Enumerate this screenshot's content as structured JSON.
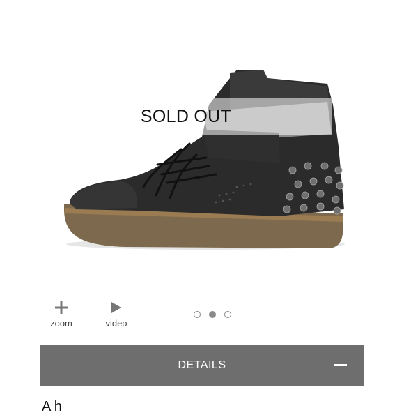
{
  "product": {
    "sold_out_label": "SOLD OUT",
    "image_alt": "high-top-sneaker"
  },
  "toolbar": {
    "zoom_label": "zoom",
    "video_label": "video",
    "zoom_icon": "plus-icon",
    "video_icon": "play-icon"
  },
  "carousel": {
    "total": 3,
    "active_index": 2
  },
  "details": {
    "label": "DETAILS",
    "toggle_icon": "minus-icon",
    "bar_color": "#6e6e6e"
  },
  "description": {
    "partial_text": "A h"
  }
}
